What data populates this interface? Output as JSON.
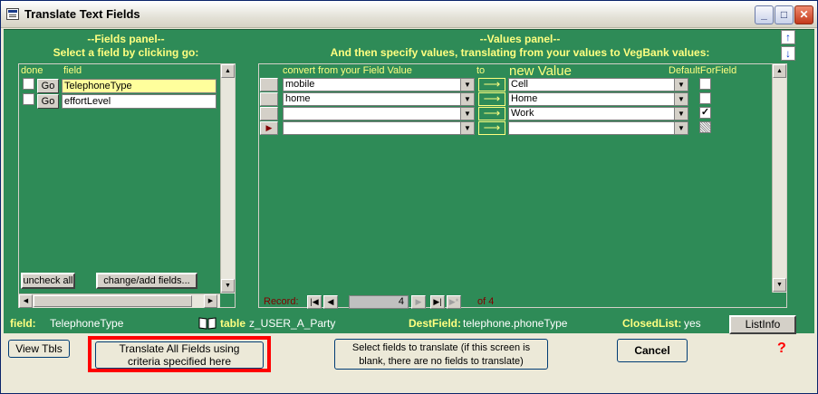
{
  "window": {
    "title": "Translate Text Fields",
    "controls": {
      "minimize": "_",
      "maximize": "□",
      "close": "✕"
    }
  },
  "fields_panel": {
    "header_line1": "--Fields panel--",
    "header_line2": "Select a field by clicking go:",
    "col_done": "done",
    "col_field": "field",
    "go_label": "Go",
    "rows": [
      {
        "done": false,
        "field": "TelephoneType",
        "selected": true
      },
      {
        "done": false,
        "field": "effortLevel",
        "selected": false
      }
    ],
    "uncheck_all": "uncheck all",
    "change_add_fields": "change/add fields..."
  },
  "values_panel": {
    "header_line1": "--Values panel--",
    "header_line2": "And then specify values, translating from your values to VegBank values:",
    "col_convert": "convert from your Field Value",
    "col_to": "to",
    "col_new_value": "new Value",
    "col_default": "DefaultForField",
    "rows": [
      {
        "from": "mobile",
        "to": "Cell",
        "default": false
      },
      {
        "from": "home",
        "to": "Home",
        "default": false
      },
      {
        "from": "",
        "to": "Work",
        "default": true
      },
      {
        "from": "",
        "to": "",
        "default": null
      }
    ],
    "arrow_glyph": "⟶",
    "record_label": "Record:",
    "record_current": "4",
    "record_of": "of 4"
  },
  "status": {
    "field_label": "field:",
    "field_value": "TelephoneType",
    "table_label": "table",
    "table_value": "z_USER_A_Party",
    "destfield_label": "DestField:",
    "destfield_value": "telephone.phoneType",
    "closedlist_label": "ClosedList:",
    "closedlist_value": "yes",
    "listinfo_button": "ListInfo"
  },
  "buttons": {
    "view_tbls": "View Tbls",
    "translate_all_line1": "Translate All Fields using",
    "translate_all_line2": "criteria specified here",
    "select_fields_line1": "Select fields to translate (if this screen is",
    "select_fields_line2": "blank, there are no fields to translate)",
    "cancel": "Cancel",
    "help": "?"
  },
  "colors": {
    "panel_green": "#2e8b57",
    "header_yellow": "#ffff80",
    "highlight_red": "#ff0000",
    "selected_field": "#ffff9c"
  }
}
